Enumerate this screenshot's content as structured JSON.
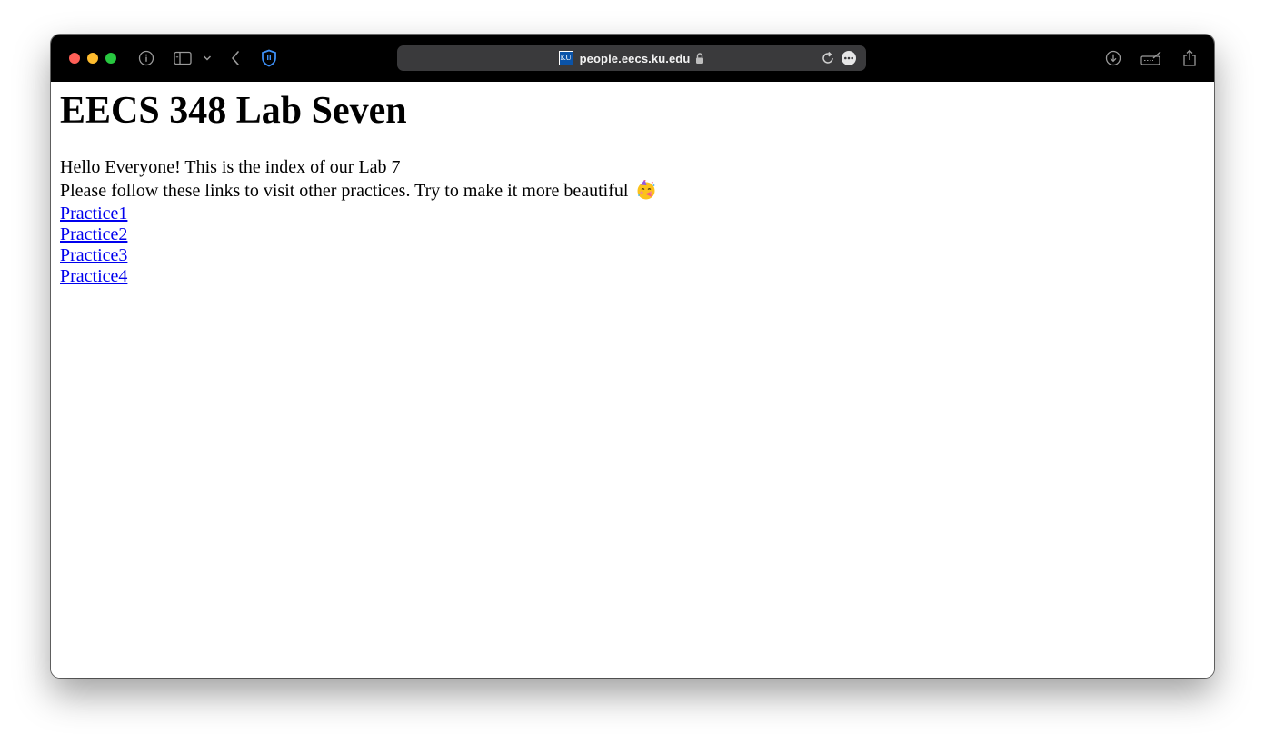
{
  "browser": {
    "url": "people.eecs.ku.edu",
    "favicon_text": "KU",
    "traffic_lights": {
      "close": "#ff5f57",
      "minimize": "#febc2e",
      "zoom": "#28c840"
    },
    "icons": [
      "info-icon",
      "sidebar-icon",
      "chevron-down-icon",
      "back-icon",
      "shield-icon",
      "lock-icon",
      "reload-icon",
      "more-icon",
      "download-icon",
      "markup-icon",
      "share-icon"
    ]
  },
  "page": {
    "heading": "EECS 348 Lab Seven",
    "greeting": "Hello Everyone! This is the index of our Lab 7",
    "instruction": "Please follow these links to visit other practices. Try to make it more beautiful",
    "emoji": "🥳",
    "links": [
      {
        "label": "Practice1"
      },
      {
        "label": "Practice2"
      },
      {
        "label": "Practice3"
      },
      {
        "label": "Practice4"
      }
    ],
    "link_color": "#0000ee"
  }
}
